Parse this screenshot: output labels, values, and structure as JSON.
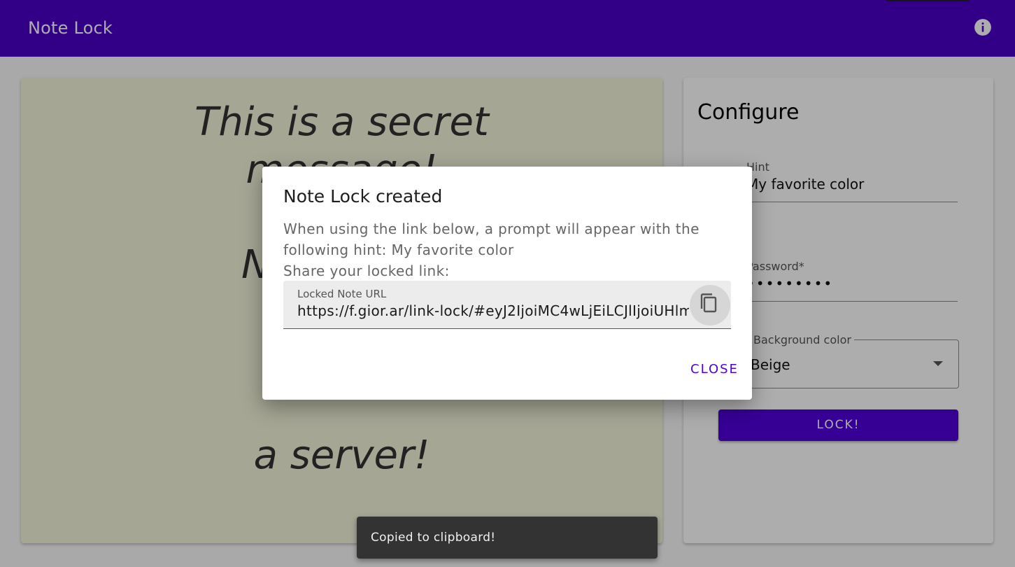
{
  "appbar": {
    "title": "Note Lock",
    "info_icon": "info-icon"
  },
  "note": {
    "lines": [
      "This is a secret",
      "message!",
      "",
      "N",
      "",
      "",
      "",
      "a server!"
    ],
    "background": "#f5f5dc"
  },
  "config": {
    "title": "Configure",
    "hint_label": "Hint",
    "hint_value": "My favorite color",
    "password_label": "Password*",
    "password_value": "•••••••••",
    "bg_label": "Background color",
    "bg_value": "Beige",
    "lock_label": "LOCK!"
  },
  "dialog": {
    "title": "Note Lock created",
    "body_line1": "When using the link below, a prompt will appear with the",
    "body_line2": "following hint: My favorite color",
    "body_line3": "Share your locked link:",
    "url_label": "Locked Note URL",
    "url_value": "https://f.gior.ar/link-lock/#eyJ2IjoiMC4wLjEiLCJlIjoiUHlm",
    "copy_icon": "copy-icon",
    "close_label": "CLOSE"
  },
  "snackbar": {
    "message": "Copied to clipboard!"
  },
  "colors": {
    "primary": "#4a00c8",
    "accent": "#5000dc"
  }
}
